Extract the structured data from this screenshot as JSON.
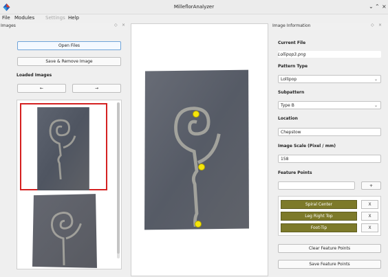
{
  "window": {
    "title": "MilleflorAnalyzer"
  },
  "menubar": {
    "items": [
      "File",
      "Modules",
      "Settings",
      "Help"
    ]
  },
  "images_dock": {
    "title": "Images",
    "open_files": "Open Files",
    "save_remove": "Save & Remove Image",
    "loaded_images_label": "Loaded Images",
    "prev_arrow": "←",
    "next_arrow": "→"
  },
  "info_dock": {
    "title": "Image Information",
    "current_file_label": "Current File",
    "current_file_value": "Lollipop3.png",
    "pattern_type_label": "Pattern Type",
    "pattern_type_value": "Lollipop",
    "subpattern_label": "Subpattern",
    "subpattern_value": "Type B",
    "location_label": "Location",
    "location_value": "Chepstow",
    "scale_label": "Image Scale (Pixel / mm)",
    "scale_value": "158",
    "feature_points_label": "Feature Points",
    "add_button": "+",
    "feature_points": [
      "Spiral Center",
      "Leg Right Top",
      "Foot-Tip"
    ],
    "remove_label": "X",
    "clear_button": "Clear Feature Points",
    "save_button": "Save Feature Points"
  },
  "colors": {
    "feature_button": "#7d7a2a",
    "selection_border": "#d42020",
    "marker": "#f5e50a"
  }
}
